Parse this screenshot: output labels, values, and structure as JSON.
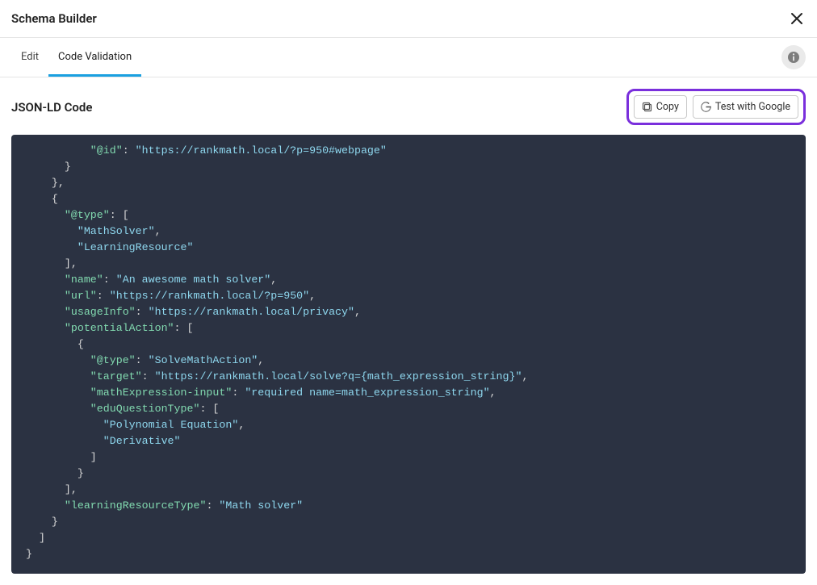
{
  "header": {
    "title": "Schema Builder"
  },
  "tabs": {
    "items": [
      {
        "label": "Edit"
      },
      {
        "label": "Code Validation"
      }
    ],
    "activeIndex": 1
  },
  "section": {
    "title": "JSON-LD Code",
    "copy_label": "Copy",
    "test_label": "Test with Google"
  },
  "code": {
    "id_key": "\"@id\"",
    "id_val": "\"https://rankmath.local/?p=950#webpage\"",
    "type_key": "\"@type\"",
    "type_v1": "\"MathSolver\"",
    "type_v2": "\"LearningResource\"",
    "name_key": "\"name\"",
    "name_val": "\"An awesome math solver\"",
    "url_key": "\"url\"",
    "url_val": "\"https://rankmath.local/?p=950\"",
    "usage_key": "\"usageInfo\"",
    "usage_val": "\"https://rankmath.local/privacy\"",
    "potential_key": "\"potentialAction\"",
    "pa_type_key": "\"@type\"",
    "pa_type_val": "\"SolveMathAction\"",
    "target_key": "\"target\"",
    "target_val": "\"https://rankmath.local/solve?q={math_expression_string}\"",
    "mathexp_key": "\"mathExpression-input\"",
    "mathexp_val": "\"required name=math_expression_string\"",
    "eduq_key": "\"eduQuestionType\"",
    "eduq_v1": "\"Polynomial Equation\"",
    "eduq_v2": "\"Derivative\"",
    "lrt_key": "\"learningResourceType\"",
    "lrt_val": "\"Math solver\"",
    "punct": {
      "colon_sp": ": ",
      "comma": ",",
      "open_arr": "[",
      "close_arr": "]",
      "open_obj": "{",
      "close_obj": "}",
      "close_obj_comma": "},",
      "close_arr_comma": "],"
    }
  },
  "icons": {
    "close": "close-icon",
    "info": "info-icon",
    "copy": "copy-icon",
    "google": "google-icon"
  },
  "colors": {
    "key": "#82dab0",
    "str": "#8ed7ee",
    "punct": "#d6d6d6",
    "highlight": "#7a2fdc",
    "tab_active": "#1aa0e0",
    "code_bg": "#2b3242"
  }
}
